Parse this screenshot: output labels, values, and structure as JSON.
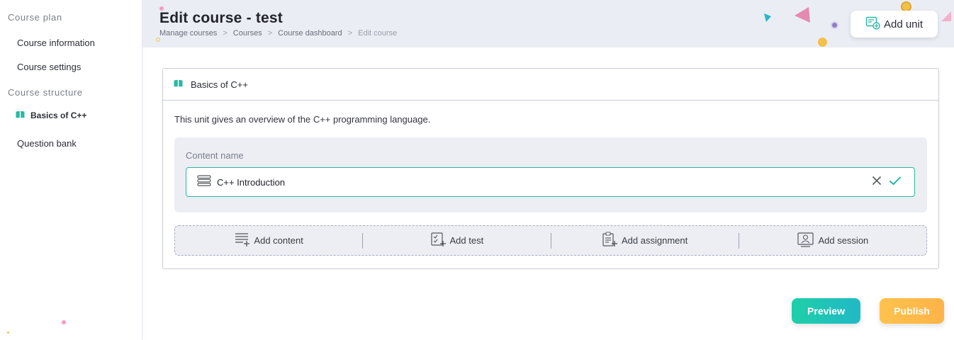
{
  "sidebar": {
    "heading_plan": "Course plan",
    "item_course_information": "Course information",
    "item_course_settings": "Course settings",
    "heading_structure": "Course structure",
    "item_unit": "Basics of C++",
    "item_question_bank": "Question bank"
  },
  "header": {
    "title": "Edit course - test",
    "breadcrumb": [
      "Manage courses",
      "Courses",
      "Course dashboard",
      "Edit course"
    ],
    "breadcrumb_sep": ">",
    "add_unit_label": "Add unit"
  },
  "unit": {
    "title": "Basics of C++",
    "description": "This unit gives an overview of the C++ programming language.",
    "content_label": "Content name",
    "content_value": "C++ Introduction"
  },
  "add_bar": {
    "add_content": "Add content",
    "add_test": "Add test",
    "add_assignment": "Add assignment",
    "add_session": "Add session"
  },
  "actions": {
    "preview": "Preview",
    "publish": "Publish"
  },
  "colors": {
    "accent_teal": "#2bb7a3",
    "preview_bg": "#1fcfa8",
    "publish_bg": "#ffbd4a",
    "header_bg": "#ebedf4"
  },
  "icons": {
    "unit": "open-book-icon",
    "add_unit": "add-unit-icon",
    "content": "list-icon",
    "clear": "close-icon",
    "confirm": "check-icon"
  }
}
